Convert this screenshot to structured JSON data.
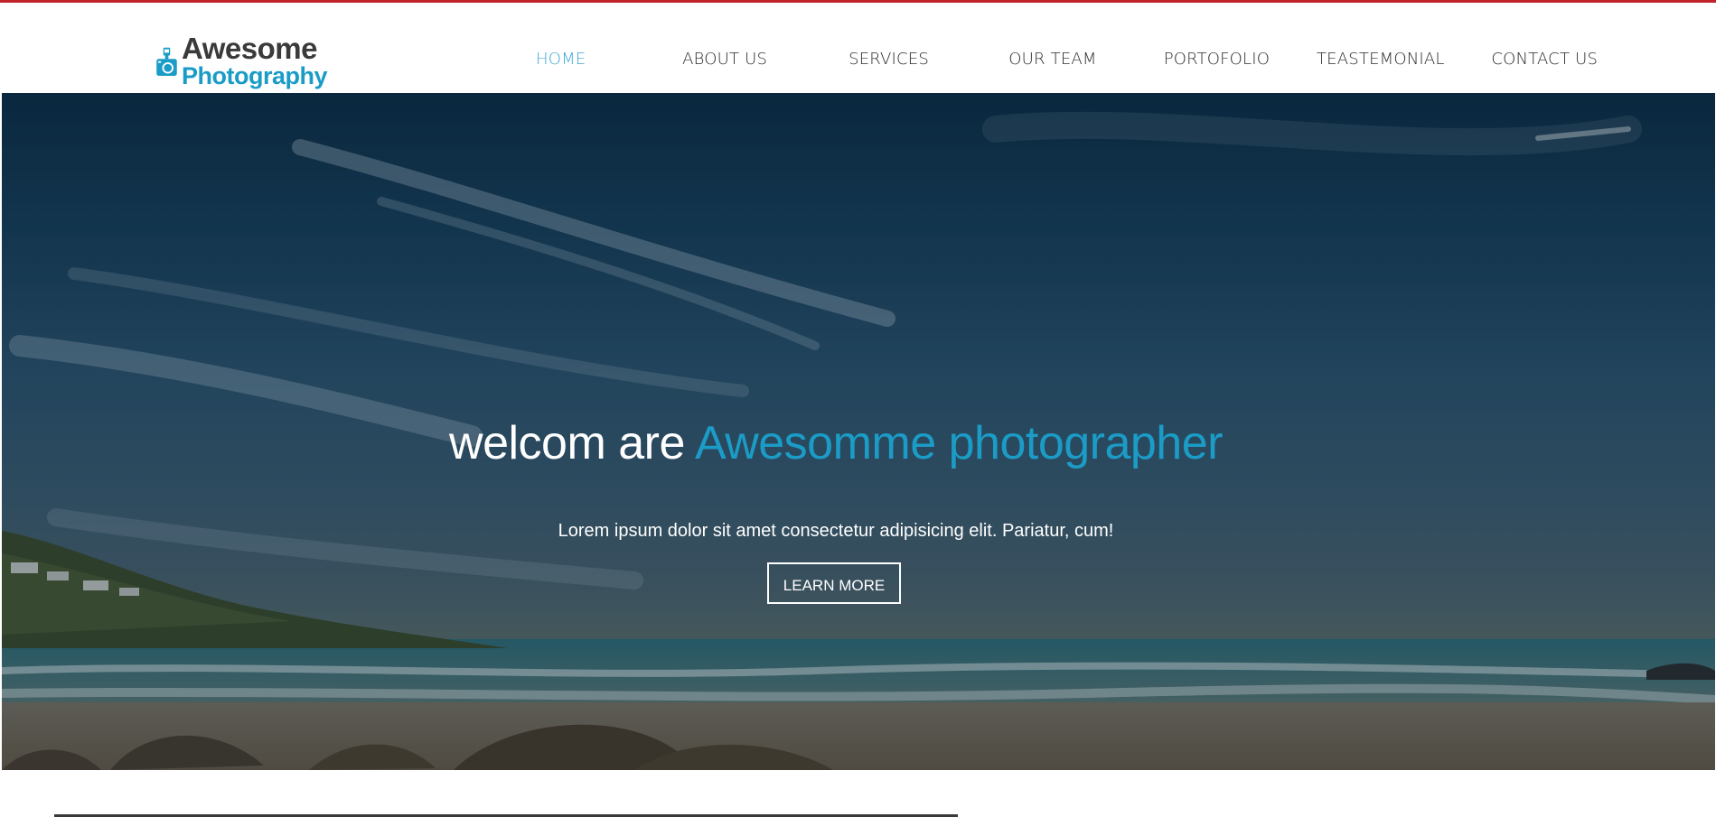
{
  "brand": {
    "name_line1": "Awesome",
    "name_line2": "Photography",
    "icon": "camera-icon",
    "colors": {
      "dark": "#3a3a3a",
      "accent": "#1b9cc7"
    }
  },
  "nav": {
    "items": [
      {
        "label": "HOME",
        "active": true
      },
      {
        "label": "ABOUT US",
        "active": false
      },
      {
        "label": "SERVICES",
        "active": false
      },
      {
        "label": "OUR TEAM",
        "active": false
      },
      {
        "label": "PORTOFOLIO",
        "active": false
      },
      {
        "label": "TEASTEMONIAL",
        "active": false
      },
      {
        "label": "CONTACT US",
        "active": false
      }
    ],
    "active_color": "#3ea8d6"
  },
  "hero": {
    "title_plain": "welcom are",
    "title_accent": "Awesomme photographer",
    "subtitle": "Lorem ipsum dolor sit amet consectetur adipisicing elit. Pariatur, cum!",
    "cta_label": "LEARN MORE"
  },
  "theme": {
    "top_border_color": "#c0232a"
  }
}
